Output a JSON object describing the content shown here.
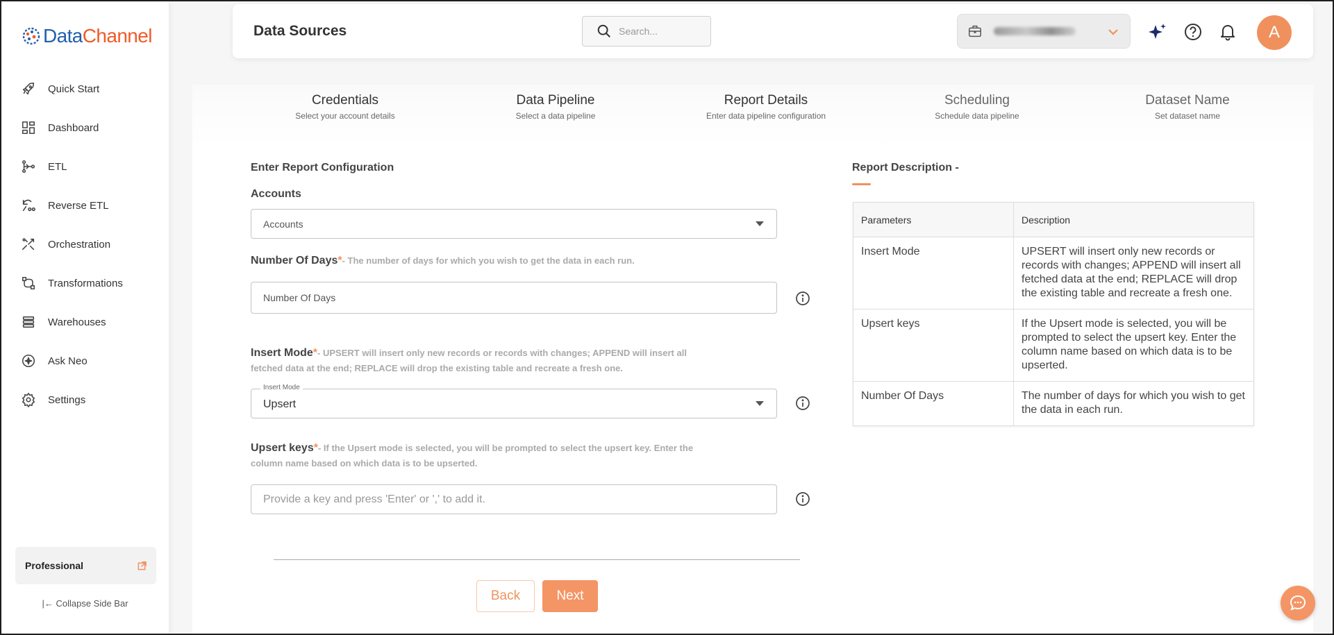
{
  "brand": {
    "name_part1": "Data",
    "name_part2": "Channel",
    "colors": {
      "blue": "#1f5fae",
      "orange": "#f05a28",
      "accent": "#f0915d"
    }
  },
  "sidebar": {
    "items": [
      {
        "label": "Quick Start",
        "icon": "rocket-icon"
      },
      {
        "label": "Dashboard",
        "icon": "dashboard-icon"
      },
      {
        "label": "ETL",
        "icon": "etl-icon"
      },
      {
        "label": "Reverse ETL",
        "icon": "reverse-etl-icon"
      },
      {
        "label": "Orchestration",
        "icon": "orchestration-icon"
      },
      {
        "label": "Transformations",
        "icon": "transformations-icon"
      },
      {
        "label": "Warehouses",
        "icon": "warehouses-icon"
      },
      {
        "label": "Ask Neo",
        "icon": "ask-neo-icon"
      },
      {
        "label": "Settings",
        "icon": "gear-icon"
      }
    ],
    "plan_label": "Professional",
    "collapse_label": "Collapse Side Bar"
  },
  "header": {
    "title": "Data Sources",
    "search_placeholder": "Search...",
    "avatar_initial": "A"
  },
  "steps": [
    {
      "title": "Credentials",
      "subtitle": "Select your account details"
    },
    {
      "title": "Data Pipeline",
      "subtitle": "Select a data pipeline"
    },
    {
      "title": "Report Details",
      "subtitle": "Enter data pipeline configuration"
    },
    {
      "title": "Scheduling",
      "subtitle": "Schedule data pipeline"
    },
    {
      "title": "Dataset Name",
      "subtitle": "Set dataset name"
    }
  ],
  "form": {
    "heading": "Enter Report Configuration",
    "accounts": {
      "label": "Accounts",
      "value": "Accounts"
    },
    "days": {
      "label": "Number Of Days",
      "required": "*",
      "hint": "- The number of days for which you wish to get the data in each run.",
      "placeholder": "Number Of Days"
    },
    "insert_mode": {
      "label": "Insert Mode",
      "required": "*",
      "hint": "- UPSERT will insert only new records or records with changes; APPEND will insert all fetched data at the end; REPLACE will drop the existing table and recreate a fresh one.",
      "float_label": "Insert Mode",
      "value": "Upsert"
    },
    "upsert_keys": {
      "label": "Upsert keys",
      "required": "*",
      "hint": "- If the Upsert mode is selected, you will be prompted to select the upsert key. Enter the column name based on which data is to be upserted.",
      "placeholder": "Provide a key and press 'Enter' or ',' to add it."
    },
    "back_label": "Back",
    "next_label": "Next"
  },
  "report_description": {
    "title": "Report Description -",
    "headers": {
      "param": "Parameters",
      "desc": "Description"
    },
    "rows": [
      {
        "param": "Insert Mode",
        "desc": "UPSERT will insert only new records or records with changes; APPEND will insert all fetched data at the end; REPLACE will drop the existing table and recreate a fresh one."
      },
      {
        "param": "Upsert keys",
        "desc": "If the Upsert mode is selected, you will be prompted to select the upsert key. Enter the column name based on which data is to be upserted."
      },
      {
        "param": "Number Of Days",
        "desc": "The number of days for which you wish to get the data in each run."
      }
    ]
  }
}
